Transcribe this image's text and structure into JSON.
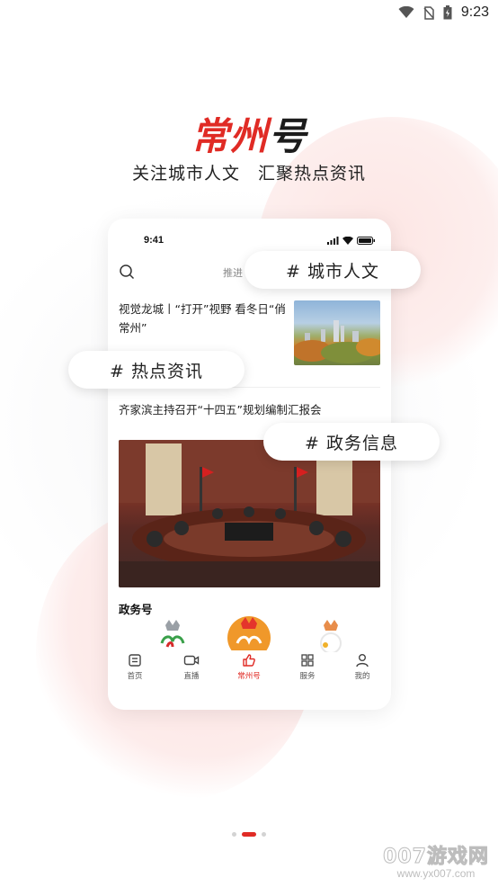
{
  "status_bar": {
    "time": "9:23",
    "icons": [
      "wifi-icon",
      "no-sim-icon",
      "battery-charging-icon"
    ]
  },
  "brand": {
    "logo_part1": "常州",
    "logo_part2": "号",
    "slogan_left": "关注城市人文",
    "slogan_right": "汇聚热点资讯"
  },
  "phone": {
    "time": "9:41",
    "tab_recommend": "推进",
    "article1_title": "视觉龙城丨“打开”视野 看冬日“俏常州”",
    "article2_title": "齐家滨主持召开“十四五”规划编制汇报会",
    "section_title": "政务号",
    "tabs": [
      {
        "label": "首页",
        "icon": "home-doc-icon",
        "active": false
      },
      {
        "label": "直播",
        "icon": "video-camera-icon",
        "active": false
      },
      {
        "label": "常州号",
        "icon": "thumbs-up-icon",
        "active": true
      },
      {
        "label": "服务",
        "icon": "grid-icon",
        "active": false
      },
      {
        "label": "我的",
        "icon": "user-icon",
        "active": false
      }
    ]
  },
  "tags": {
    "tag1": "# 城市人文",
    "tag2": "# 热点资讯",
    "tag3": "# 政务信息"
  },
  "pagination": {
    "pages": 3,
    "current": 2
  },
  "watermark": {
    "main": "007游戏网",
    "url": "www.yx007.com"
  },
  "colors": {
    "accent": "#e02b25",
    "text": "#222222"
  }
}
